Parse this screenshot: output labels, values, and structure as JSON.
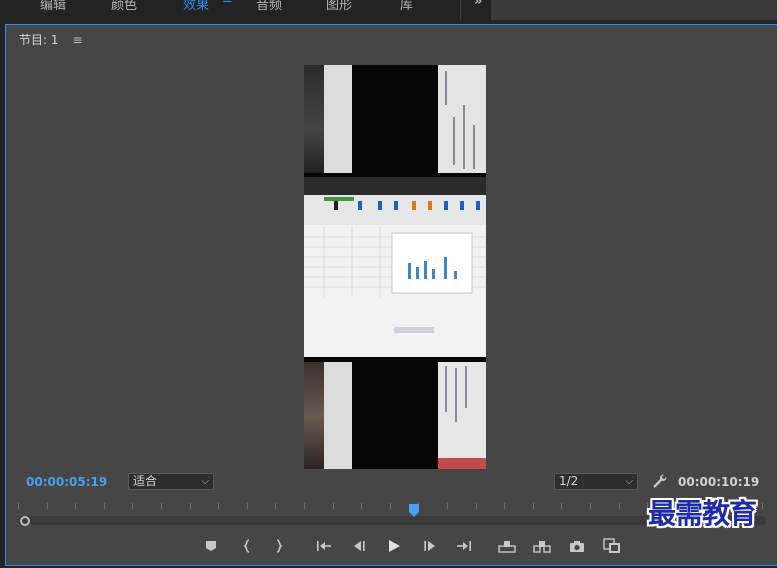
{
  "workspace_tabs": [
    {
      "label": "编辑",
      "active": false
    },
    {
      "label": "颜色",
      "active": false
    },
    {
      "label": "效果",
      "active": true
    },
    {
      "label": "音频",
      "active": false
    },
    {
      "label": "图形",
      "active": false
    },
    {
      "label": "库",
      "active": false
    }
  ],
  "workspace_menu_icon": "hamburger-icon",
  "workspace_overflow": "»",
  "panel": {
    "title": "节目: 1",
    "menu_icon": "≡",
    "accent_color": "#2d8ceb"
  },
  "playback": {
    "current_timecode": "00:00:05:19",
    "duration_timecode": "00:00:10:19",
    "zoom_select": "适合",
    "resolution_select": "1/2",
    "playhead_fraction": 0.53
  },
  "transport_icons": [
    "add-marker-icon",
    "mark-in-icon",
    "mark-out-icon",
    "go-to-in-icon",
    "step-back-icon",
    "play-icon",
    "step-forward-icon",
    "go-to-out-icon",
    "lift-icon",
    "extract-icon",
    "export-frame-icon",
    "compare-view-icon"
  ],
  "watermark": "最需教育"
}
